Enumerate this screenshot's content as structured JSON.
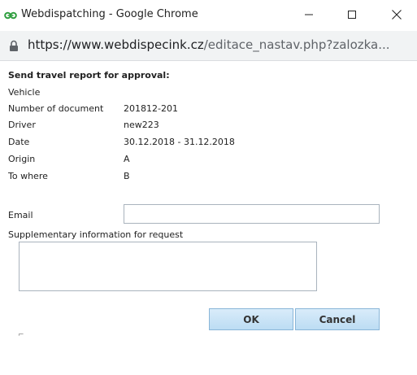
{
  "window": {
    "title": "Webdispatching - Google Chrome",
    "url_origin": "https://www.webdispecink.cz",
    "url_path": "/editace_nastav.php?zalozka..."
  },
  "form": {
    "heading": "Send travel report for approval:",
    "rows": [
      {
        "label": "Vehicle",
        "value": ""
      },
      {
        "label": "Number of document",
        "value": "201812-201"
      },
      {
        "label": "Driver",
        "value": "new223"
      },
      {
        "label": "Date",
        "value": "30.12.2018 - 31.12.2018"
      },
      {
        "label": "Origin",
        "value": "A"
      },
      {
        "label": "To where",
        "value": "B"
      }
    ],
    "email_label": "Email",
    "email_value": "",
    "supplementary_label": "Supplementary information for request",
    "supplementary_value": "",
    "ok_label": "OK",
    "cancel_label": "Cancel",
    "corner_mark": "⌐"
  },
  "icons": {
    "app": "webdispatching-logo-icon",
    "minimize": "minimize-icon",
    "maximize": "maximize-icon",
    "close": "close-icon",
    "lock": "lock-icon"
  },
  "colors": {
    "app_icon": "#2e9e3e",
    "button_bg": "#c9e3f6",
    "button_border": "#8ab6d8",
    "addressbar_bg": "#f1f3f4"
  }
}
